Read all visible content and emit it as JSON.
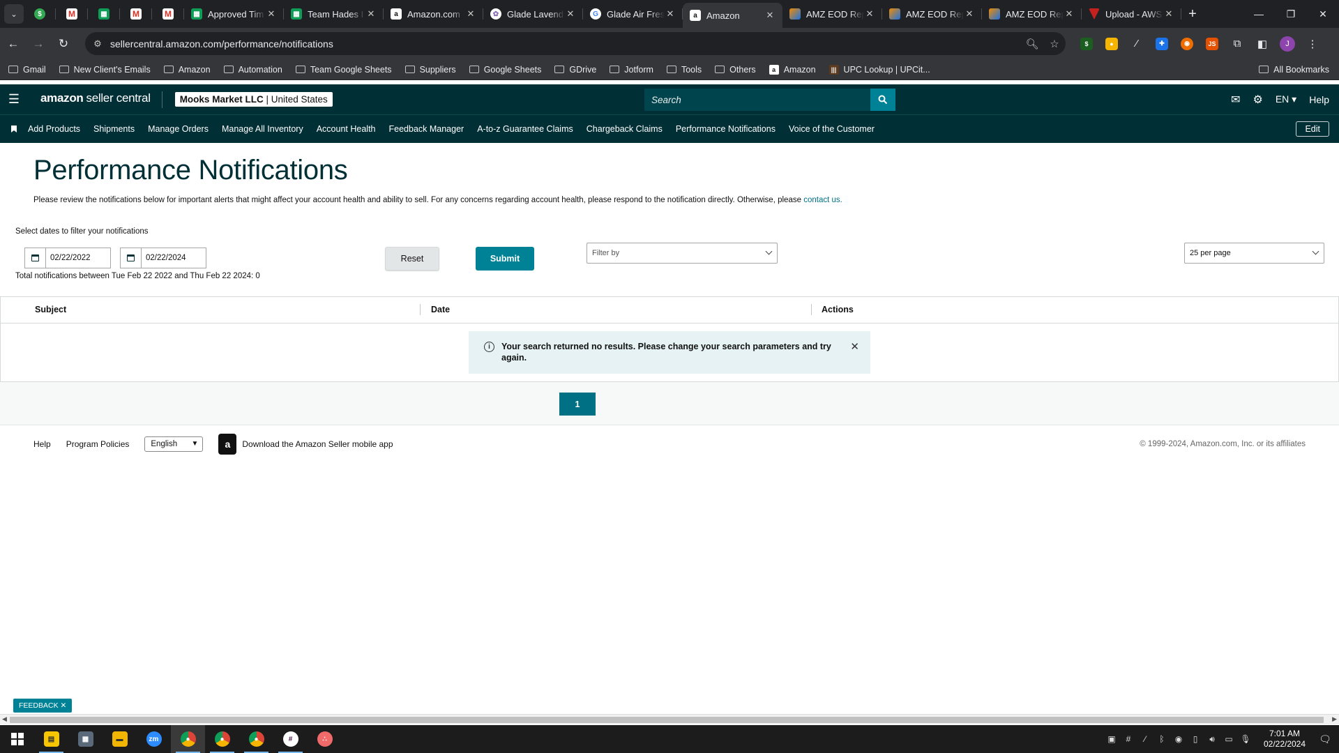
{
  "browser": {
    "tabs": [
      {
        "title": "Approved Tim",
        "icon": "sheets"
      },
      {
        "title": "Team Hades I",
        "icon": "sheets"
      },
      {
        "title": "Amazon.com",
        "icon": "amazon"
      },
      {
        "title": "Glade Lavend",
        "icon": "glade"
      },
      {
        "title": "Glade Air Fres",
        "icon": "google"
      },
      {
        "title": "Amazon",
        "icon": "amazon",
        "active": true
      },
      {
        "title": "AMZ EOD Rep",
        "icon": "eod"
      },
      {
        "title": "AMZ EOD Rep",
        "icon": "eod"
      },
      {
        "title": "AMZ EOD Rep",
        "icon": "eod"
      },
      {
        "title": "Upload - AWS",
        "icon": "upload"
      }
    ],
    "url": "sellercentral.amazon.com/performance/notifications",
    "bookmarks": [
      {
        "label": "Gmail",
        "type": "folder"
      },
      {
        "label": "New Client's Emails",
        "type": "folder"
      },
      {
        "label": "Amazon",
        "type": "folder"
      },
      {
        "label": "Automation",
        "type": "folder"
      },
      {
        "label": "Team Google Sheets",
        "type": "folder"
      },
      {
        "label": "Suppliers",
        "type": "folder"
      },
      {
        "label": "Google Sheets",
        "type": "folder"
      },
      {
        "label": "GDrive",
        "type": "folder"
      },
      {
        "label": "Jotform",
        "type": "folder"
      },
      {
        "label": "Tools",
        "type": "folder"
      },
      {
        "label": "Others",
        "type": "folder"
      },
      {
        "label": "Amazon",
        "type": "amazon"
      },
      {
        "label": "UPC Lookup | UPCit...",
        "type": "upc"
      }
    ],
    "all_bookmarks": "All Bookmarks",
    "profile_initial": "J"
  },
  "header": {
    "logo_bold": "amazon",
    "logo_rest": "seller central",
    "account_name": "Mooks Market LLC",
    "account_region": "United States",
    "search_placeholder": "Search",
    "language": "EN",
    "help": "Help"
  },
  "nav": {
    "items": [
      "Add Products",
      "Shipments",
      "Manage Orders",
      "Manage All Inventory",
      "Account Health",
      "Feedback Manager",
      "A-to-z Guarantee Claims",
      "Chargeback Claims",
      "Performance Notifications",
      "Voice of the Customer"
    ],
    "edit": "Edit"
  },
  "page": {
    "title": "Performance Notifications",
    "description": "Please review the notifications below for important alerts that might affect your account health and ability to sell. For any concerns regarding account health, please respond to the notification directly. Otherwise, please",
    "contact_link": "contact us.",
    "filter_label": "Select dates to filter your notifications",
    "date_from": "02/22/2022",
    "date_to": "02/22/2024",
    "total": "Total notifications between Tue Feb 22 2022 and Thu Feb 22 2024: 0",
    "reset": "Reset",
    "submit": "Submit",
    "filter_by": "Filter by",
    "per_page": "25 per page",
    "columns": [
      "Subject",
      "Date",
      "Actions"
    ],
    "no_results": "Your search returned no results. Please change your search parameters and try again.",
    "current_page": "1"
  },
  "footer": {
    "help": "Help",
    "program_policies": "Program Policies",
    "language": "English",
    "app_label": "Download the Amazon Seller mobile app",
    "copyright": "© 1999-2024, Amazon.com, Inc. or its affiliates"
  },
  "feedback": "FEEDBACK",
  "taskbar": {
    "time": "7:01 AM",
    "date": "02/22/2024"
  }
}
